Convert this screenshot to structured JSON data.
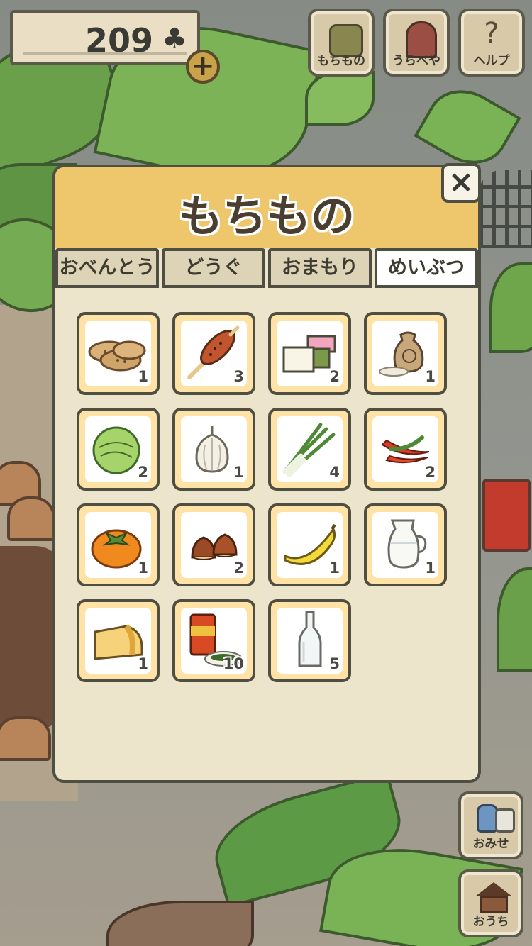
{
  "wallet": {
    "clovers": "209",
    "clover_icon": "♣",
    "plus_label": "+"
  },
  "top_buttons": [
    {
      "label": "もちもの",
      "icon": "bag-icon"
    },
    {
      "label": "うらべや",
      "icon": "door-icon"
    },
    {
      "label": "ヘルプ",
      "icon": "help-icon",
      "glyph": "?"
    }
  ],
  "side_buttons": [
    {
      "label": "おみせ",
      "icon": "shop-icon"
    },
    {
      "label": "おうち",
      "icon": "house-icon"
    }
  ],
  "panel": {
    "title": "もちもの",
    "close_glyph": "×",
    "tabs": [
      {
        "label": "おべんとう",
        "active": false
      },
      {
        "label": "どうぐ",
        "active": false
      },
      {
        "label": "おまもり",
        "active": false
      },
      {
        "label": "めいぶつ",
        "active": true
      }
    ],
    "items": [
      {
        "icon": "rice-crackers-icon",
        "count": "1"
      },
      {
        "icon": "grilled-mochi-skewer-icon",
        "count": "3"
      },
      {
        "icon": "uiro-sweets-icon",
        "count": "2"
      },
      {
        "icon": "rice-sack-icon",
        "count": "1"
      },
      {
        "icon": "cabbage-icon",
        "count": "2"
      },
      {
        "icon": "garlic-icon",
        "count": "1"
      },
      {
        "icon": "green-onion-icon",
        "count": "4"
      },
      {
        "icon": "chili-pepper-icon",
        "count": "2"
      },
      {
        "icon": "persimmon-icon",
        "count": "1"
      },
      {
        "icon": "chestnut-icon",
        "count": "2"
      },
      {
        "icon": "banana-icon",
        "count": "1"
      },
      {
        "icon": "milk-pitcher-icon",
        "count": "1"
      },
      {
        "icon": "cheese-icon",
        "count": "1"
      },
      {
        "icon": "tea-canister-icon",
        "count": "10"
      },
      {
        "icon": "glass-bottle-icon",
        "count": "5"
      }
    ]
  }
}
